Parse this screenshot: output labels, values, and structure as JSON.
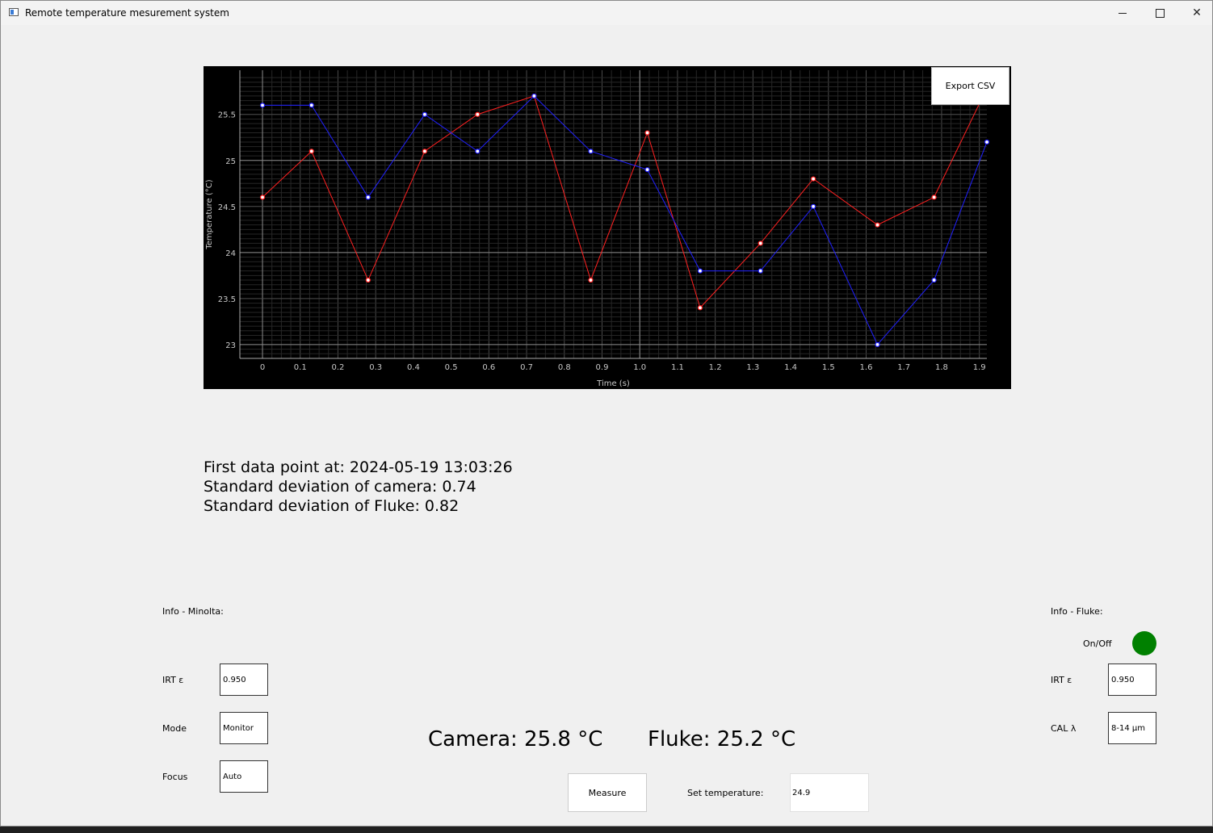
{
  "window": {
    "title": "Remote temperature mesurement system"
  },
  "chart": {
    "export_label": "Export CSV"
  },
  "chart_data": {
    "type": "line",
    "xlabel": "Time (s)",
    "ylabel": "Temperature (°C)",
    "xlim": [
      -0.06,
      1.92
    ],
    "ylim": [
      22.85,
      25.98
    ],
    "x_ticks": [
      "0",
      "0.1",
      "0.2",
      "0.3",
      "0.4",
      "0.5",
      "0.6",
      "0.7",
      "0.8",
      "0.9",
      "1.0",
      "1.1",
      "1.2",
      "1.3",
      "1.4",
      "1.5",
      "1.6",
      "1.7",
      "1.8",
      "1.9"
    ],
    "y_ticks": [
      "23",
      "23.5",
      "24",
      "24.5",
      "25",
      "25.5"
    ],
    "grid": true,
    "series": [
      {
        "color": "#ff2020",
        "x": [
          0,
          0.13,
          0.28,
          0.43,
          0.57,
          0.72,
          0.87,
          1.02,
          1.16,
          1.32,
          1.46,
          1.63,
          1.78,
          1.91
        ],
        "values": [
          24.6,
          25.1,
          23.7,
          25.1,
          25.5,
          25.7,
          23.7,
          25.3,
          23.4,
          24.1,
          24.8,
          24.3,
          24.6,
          25.7
        ]
      },
      {
        "color": "#2020ff",
        "x": [
          0,
          0.13,
          0.28,
          0.43,
          0.57,
          0.72,
          0.87,
          1.02,
          1.16,
          1.32,
          1.46,
          1.63,
          1.78,
          1.92
        ],
        "values": [
          25.6,
          25.6,
          24.6,
          25.5,
          25.1,
          25.7,
          25.1,
          24.9,
          23.8,
          23.8,
          24.5,
          23.0,
          23.7,
          25.2
        ]
      }
    ]
  },
  "stats": {
    "first_point": "First data point at: 2024-05-19 13:03:26",
    "std_camera": "Standard deviation of camera: 0.74",
    "std_fluke": "Standard deviation of Fluke: 0.82"
  },
  "minolta": {
    "header": "Info - Minolta:",
    "irt_label": "IRT ε",
    "irt_value": "0.950",
    "mode_label": "Mode",
    "mode_value": "Monitor",
    "focus_label": "Focus",
    "focus_value": "Auto"
  },
  "fluke": {
    "header": "Info - Fluke:",
    "onoff_label": "On/Off",
    "status_color": "#008000",
    "irt_label": "IRT ε",
    "irt_value": "0.950",
    "cal_label": "CAL λ",
    "cal_value": "8-14 μm"
  },
  "readouts": {
    "camera": "Camera: 25.8 °C",
    "fluke": "Fluke: 25.2 °C"
  },
  "controls": {
    "measure_label": "Measure",
    "set_temp_label": "Set temperature:",
    "set_temp_value": "24.9"
  }
}
